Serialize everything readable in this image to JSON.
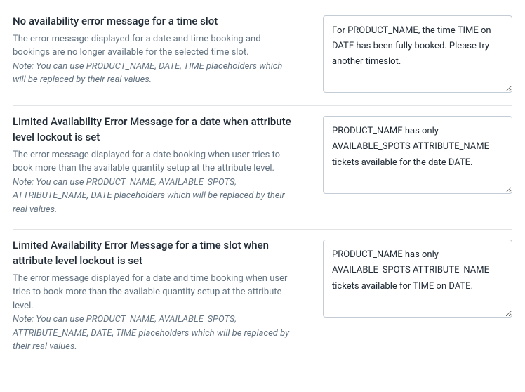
{
  "settings": [
    {
      "title": "No availability error message for a time slot",
      "description": "The error message displayed for a date and time booking and bookings are no longer available for the selected time slot.",
      "note": "Note: You can use PRODUCT_NAME, DATE, TIME placeholders which will be replaced by their real values.",
      "value": "For PRODUCT_NAME, the time TIME on DATE has been fully booked. Please try another timeslot."
    },
    {
      "title": "Limited Availability Error Message for a date when attribute level lockout is set",
      "description": "The error message displayed for a date booking when user tries to book more than the available quantity setup at the attribute level.",
      "note": "Note: You can use PRODUCT_NAME, AVAILABLE_SPOTS, ATTRIBUTE_NAME, DATE placeholders which will be replaced by their real values.",
      "value": "PRODUCT_NAME has only AVAILABLE_SPOTS ATTRIBUTE_NAME tickets available for the date DATE."
    },
    {
      "title": "Limited Availability Error Message for a time slot when attribute level lockout is set",
      "description": "The error message displayed for a date and time booking when user tries to book more than the available quantity setup at the attribute level.",
      "note": "Note: You can use PRODUCT_NAME, AVAILABLE_SPOTS, ATTRIBUTE_NAME, DATE, TIME placeholders which will be replaced by their real values.",
      "value": "PRODUCT_NAME has only AVAILABLE_SPOTS ATTRIBUTE_NAME tickets available for TIME on DATE."
    }
  ]
}
